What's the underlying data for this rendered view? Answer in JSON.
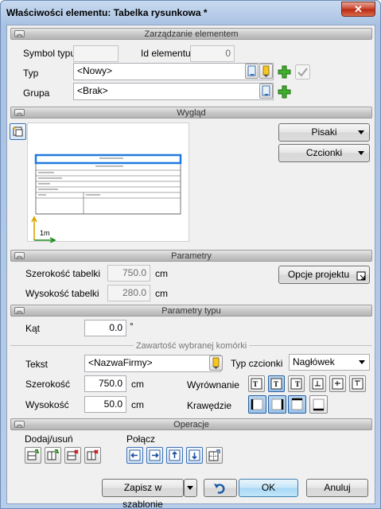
{
  "window": {
    "title": "Właściwości elementu: Tabelka rysunkowa *",
    "close_glyph": "✕"
  },
  "sections": {
    "management": "Zarządzanie elementem",
    "appearance": "Wygląd",
    "parameters": "Parametry",
    "type_parameters": "Parametry typu",
    "operations": "Operacje"
  },
  "management": {
    "symbol_label": "Symbol typu",
    "symbol_value": "",
    "id_label": "Id elementu",
    "id_value": "0",
    "type_label": "Typ",
    "type_value": "<Nowy>",
    "group_label": "Grupa",
    "group_value": "<Brak>"
  },
  "appearance": {
    "pens_button": "Pisaki",
    "fonts_button": "Czcionki",
    "scale_label": "1m"
  },
  "parameters": {
    "width_label": "Szerokość tabelki",
    "width_value": "750.0",
    "width_unit": "cm",
    "height_label": "Wysokość tabelki",
    "height_value": "280.0",
    "height_unit": "cm",
    "project_options_button": "Opcje projektu"
  },
  "type_parameters": {
    "angle_label": "Kąt",
    "angle_value": "0.0",
    "angle_unit": "°",
    "cell_content_header": "Zawartość wybranej komórki",
    "text_label": "Tekst",
    "text_value": "<NazwaFirmy>",
    "font_type_label": "Typ czcionki",
    "font_type_value": "Nagłówek",
    "cell_width_label": "Szerokość",
    "cell_width_value": "750.0",
    "cell_width_unit": "cm",
    "cell_height_label": "Wysokość",
    "cell_height_value": "50.0",
    "cell_height_unit": "cm",
    "alignment_label": "Wyrównanie",
    "edges_label": "Krawędzie"
  },
  "operations": {
    "add_remove_label": "Dodaj/usuń",
    "merge_label": "Połącz"
  },
  "footer": {
    "save_template_button": "Zapisz w szablonie",
    "ok_button": "OK",
    "cancel_button": "Anuluj"
  }
}
